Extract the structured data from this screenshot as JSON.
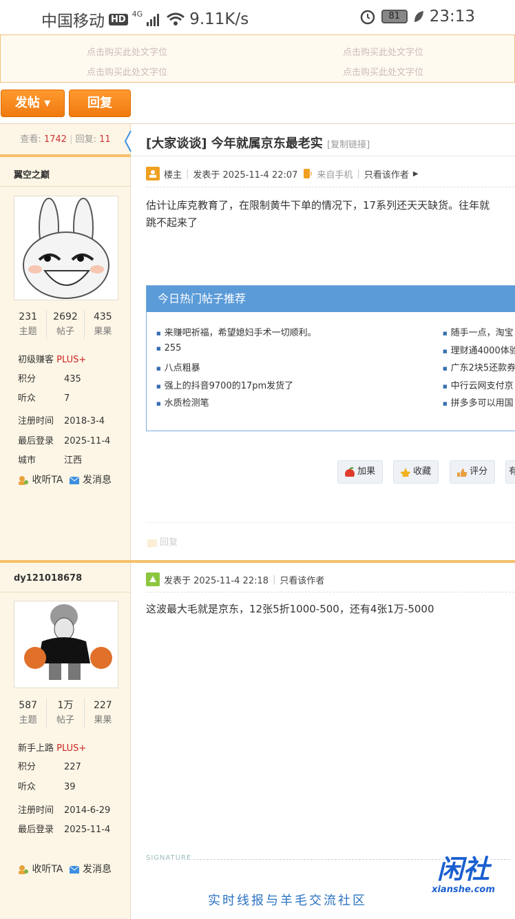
{
  "status": {
    "carrier": "中国移动",
    "hd": "HD",
    "net": "4G",
    "speed": "9.11K/s",
    "battery": "81",
    "time": "23:13"
  },
  "ad": {
    "text": "点击购买此处文字位"
  },
  "buttons": {
    "post": "发帖 ▾",
    "reply": "回复"
  },
  "thread": {
    "views_label": "查看:",
    "views": "1742",
    "replies_label": "回复:",
    "replies": "11",
    "title": "[大家谈谈] 今年就属京东最老实",
    "copy_link": "[复制链接]"
  },
  "post1": {
    "author": "翼空之巅",
    "stats": [
      {
        "v": "231",
        "l": "主题"
      },
      {
        "v": "2692",
        "l": "帖子"
      },
      {
        "v": "435",
        "l": "果果"
      }
    ],
    "rank": "初级赚客",
    "plus": "PLUS+",
    "points_label": "积分",
    "points": "435",
    "listeners_label": "听众",
    "listeners": "7",
    "reg_label": "注册时间",
    "reg": "2018-3-4",
    "last_label": "最后登录",
    "last": "2025-11-4",
    "city_label": "城市",
    "city": "江西",
    "follow": "收听TA",
    "msg": "发消息",
    "floor": "楼主",
    "posted": "发表于 2025-11-4 22:07",
    "from": "来自手机",
    "only": "只看该作者",
    "line1": "估计让库克教育了，在限制黄牛下单的情况下，17系列还天天缺货。往年就",
    "line2": "跳不起来了",
    "hot_title": "今日热门帖子推荐",
    "hot_left": [
      "来赚吧祈福，希望媳妇手术一切顺利。",
      "255",
      "八点粗暴",
      "强上的抖音9700的17pm发货了",
      "水质检测笔"
    ],
    "hot_right": [
      "随手一点，淘宝",
      "理财通4000体验",
      "广东2块5还款券",
      "中行云网支付京",
      "拼多多可以用国"
    ],
    "act_add": "加果",
    "act_fav": "收藏",
    "act_rate": "评分",
    "act_more": "有",
    "reply": "回复"
  },
  "post2": {
    "author": "dy121018678",
    "stats": [
      {
        "v": "587",
        "l": "主题"
      },
      {
        "v": "1万",
        "l": "帖子"
      },
      {
        "v": "227",
        "l": "果果"
      }
    ],
    "rank": "新手上路",
    "plus": "PLUS+",
    "points_label": "积分",
    "points": "227",
    "listeners_label": "听众",
    "listeners": "39",
    "reg_label": "注册时间",
    "reg": "2014-6-29",
    "last_label": "最后登录",
    "last": "2025-11-4",
    "follow": "收听TA",
    "msg": "发消息",
    "posted": "发表于 2025-11-4 22:18",
    "only": "只看该作者",
    "line1": "这波最大毛就是京东，12张5折1000-500，还有4张1万-5000",
    "signature": "SIGNATURE",
    "slogan": "实时线报与羊毛交流社区"
  },
  "logo": {
    "name": "闲社",
    "url": "xianshe.com"
  },
  "colors": {
    "accent": "#f07a10",
    "blue": "#5a9bd8",
    "red": "#c33"
  }
}
